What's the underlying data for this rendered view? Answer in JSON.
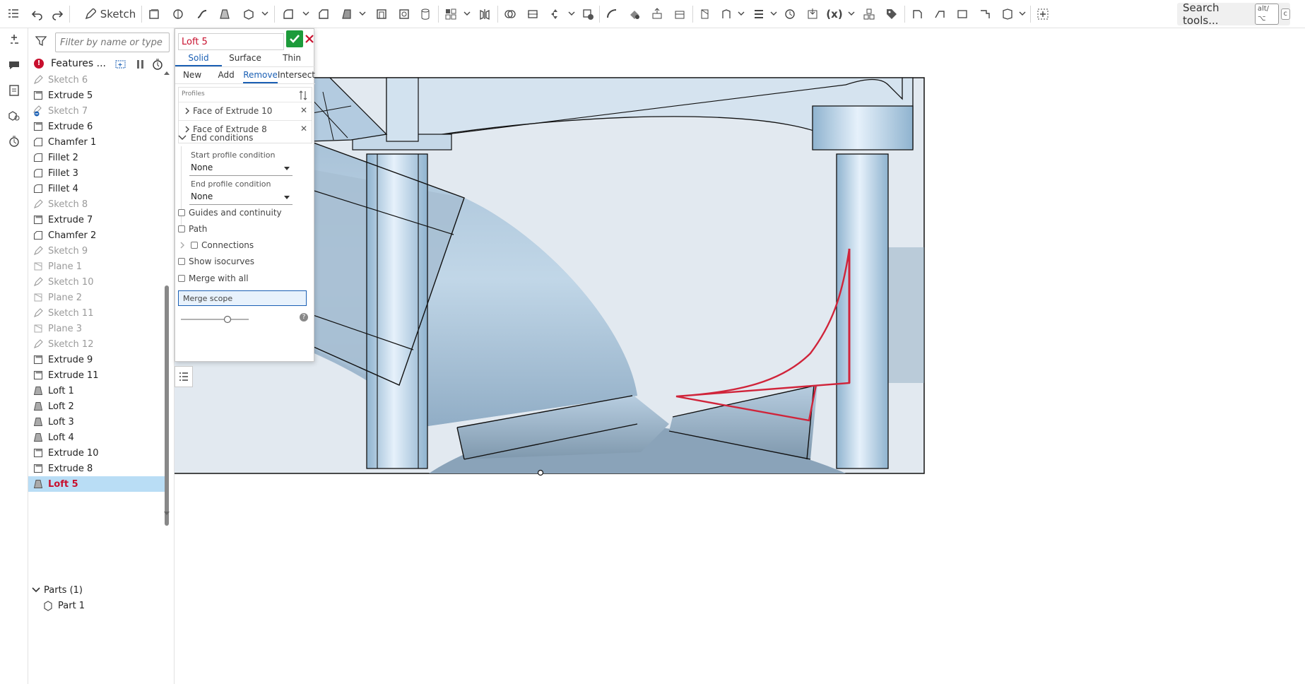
{
  "toolbar": {
    "sketch_label": "Sketch",
    "search_label": "Search tools...",
    "search_shortcut_1": "alt/⌥",
    "search_shortcut_2": "c"
  },
  "feature_panel": {
    "filter_placeholder": "Filter by name or type",
    "features_label": "Features ...",
    "features": [
      {
        "label": "Sketch 6",
        "type": "sketch",
        "dim": true
      },
      {
        "label": "Extrude 5",
        "type": "extrude",
        "dim": false
      },
      {
        "label": "Sketch 7",
        "type": "sketch-error",
        "dim": true
      },
      {
        "label": "Extrude 6",
        "type": "extrude",
        "dim": false
      },
      {
        "label": "Chamfer 1",
        "type": "chamfer",
        "dim": false
      },
      {
        "label": "Fillet 2",
        "type": "fillet",
        "dim": false
      },
      {
        "label": "Fillet 3",
        "type": "fillet",
        "dim": false
      },
      {
        "label": "Fillet 4",
        "type": "fillet",
        "dim": false
      },
      {
        "label": "Sketch 8",
        "type": "sketch",
        "dim": true
      },
      {
        "label": "Extrude 7",
        "type": "extrude",
        "dim": false
      },
      {
        "label": "Chamfer 2",
        "type": "chamfer",
        "dim": false
      },
      {
        "label": "Sketch 9",
        "type": "sketch",
        "dim": true
      },
      {
        "label": "Plane 1",
        "type": "plane",
        "dim": true
      },
      {
        "label": "Sketch 10",
        "type": "sketch",
        "dim": true
      },
      {
        "label": "Plane 2",
        "type": "plane",
        "dim": true
      },
      {
        "label": "Sketch 11",
        "type": "sketch",
        "dim": true
      },
      {
        "label": "Plane 3",
        "type": "plane",
        "dim": true
      },
      {
        "label": "Sketch 12",
        "type": "sketch",
        "dim": true
      },
      {
        "label": "Extrude 9",
        "type": "extrude",
        "dim": false
      },
      {
        "label": "Extrude 11",
        "type": "extrude",
        "dim": false
      },
      {
        "label": "Loft 1",
        "type": "loft",
        "dim": false
      },
      {
        "label": "Loft 2",
        "type": "loft",
        "dim": false
      },
      {
        "label": "Loft 3",
        "type": "loft",
        "dim": false
      },
      {
        "label": "Loft 4",
        "type": "loft",
        "dim": false
      },
      {
        "label": "Extrude 10",
        "type": "extrude",
        "dim": false
      },
      {
        "label": "Extrude 8",
        "type": "extrude",
        "dim": false
      },
      {
        "label": "Loft 5",
        "type": "loft",
        "dim": false,
        "selected": true
      }
    ],
    "parts_label": "Parts (1)",
    "part_1": "Part 1"
  },
  "loft_dialog": {
    "title": "Loft 5",
    "creation_tabs": [
      "Solid",
      "Surface",
      "Thin"
    ],
    "active_creation_tab": "Solid",
    "operation_tabs": [
      "New",
      "Add",
      "Remove",
      "Intersect"
    ],
    "active_operation_tab": "Remove",
    "profiles_label": "Profiles",
    "profiles": [
      "Face of Extrude 10",
      "Face of Extrude 8"
    ],
    "end_conditions_label": "End conditions",
    "start_profile_label": "Start profile condition",
    "start_profile_value": "None",
    "end_profile_label": "End profile condition",
    "end_profile_value": "None",
    "guides_label": "Guides and continuity",
    "path_label": "Path",
    "connections_label": "Connections",
    "isocurves_label": "Show isocurves",
    "merge_all_label": "Merge with all",
    "merge_scope_label": "Merge scope",
    "help_glyph": "?"
  },
  "colors": {
    "accent_red": "#c8102e",
    "accent_blue": "#1a5fb4",
    "ok_green": "#1d9b3b",
    "selection_bg": "#b9ddf5",
    "model_fill": "#a9bfd3",
    "highlight_edge": "#d0243a"
  }
}
